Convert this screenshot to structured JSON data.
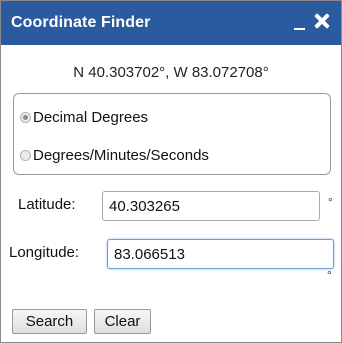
{
  "window": {
    "title": "Coordinate Finder",
    "minimize_icon": "minimize-icon",
    "close_icon": "close-icon",
    "header_color": "#2c5a9e"
  },
  "readout": {
    "text": "N 40.303702°, W 83.072708°"
  },
  "format": {
    "options": [
      {
        "label": "Decimal Degrees",
        "selected": true
      },
      {
        "label": "Degrees/Minutes/Seconds",
        "selected": false
      }
    ]
  },
  "latitude": {
    "label": "Latitude:",
    "value": "40.303265",
    "unit": "°"
  },
  "longitude": {
    "label": "Longitude:",
    "value": "83.066513",
    "unit": "°"
  },
  "buttons": {
    "search": "Search",
    "clear": "Clear"
  }
}
